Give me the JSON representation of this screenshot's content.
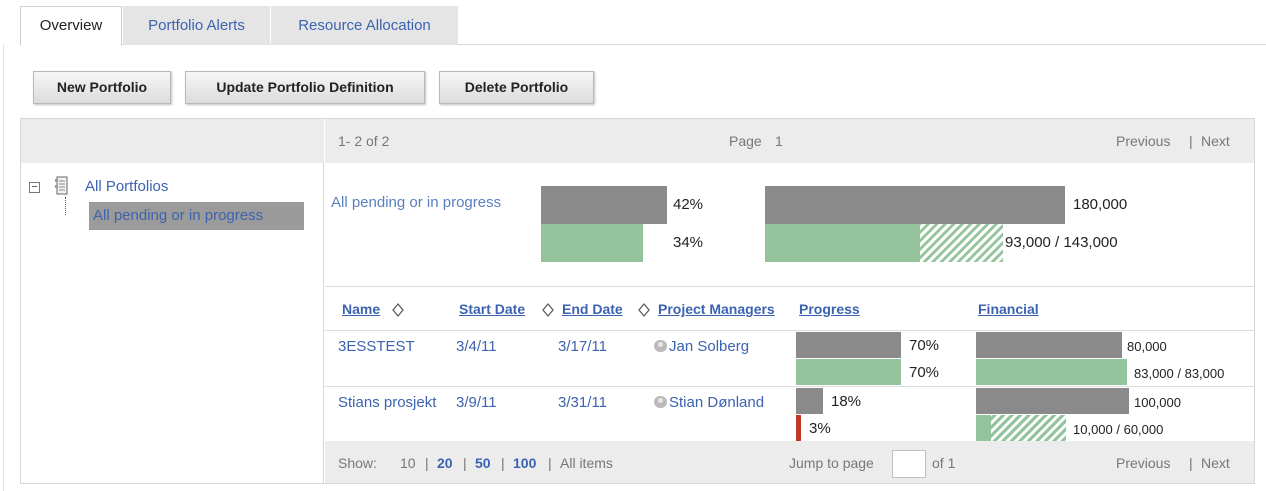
{
  "tabs": [
    {
      "label": "Overview",
      "active": true
    },
    {
      "label": "Portfolio Alerts",
      "active": false
    },
    {
      "label": "Resource Allocation",
      "active": false
    }
  ],
  "toolbar": {
    "new_label": "New Portfolio",
    "update_label": "Update Portfolio Definition",
    "delete_label": "Delete Portfolio"
  },
  "tree": {
    "root_label": "All Portfolios",
    "child_label": "All pending or in progress",
    "toggle": "−"
  },
  "pager_top": {
    "range": "1- 2  of  2",
    "page_label": "Page",
    "page_num": "1",
    "previous": "Previous",
    "divider": "|",
    "next": "Next"
  },
  "summary": {
    "name": "All pending or in progress",
    "progress_planned_label": "42%",
    "progress_planned": 0.42,
    "progress_actual_label": "34%",
    "progress_actual": 0.34,
    "financial_budget_label": "180,000",
    "financial_spent_label": "93,000 / 143,000",
    "financial_spent": 93000,
    "financial_committed": 143000,
    "financial_budget": 180000
  },
  "table": {
    "headers": {
      "name": "Name",
      "start": "Start Date",
      "end": "End Date",
      "managers": "Project Managers",
      "progress": "Progress",
      "financial": "Financial"
    },
    "rows": [
      {
        "name": "3ESSTEST",
        "start": "3/4/11",
        "end": "3/17/11",
        "manager": "Jan Solberg",
        "progress_planned_label": "70%",
        "progress_planned": 0.7,
        "progress_actual_label": "70%",
        "progress_actual": 0.7,
        "budget_label": "80,000",
        "spent_label": "83,000 / 83,000",
        "spent": 83000,
        "committed": 83000,
        "budget": 80000
      },
      {
        "name": "Stians prosjekt",
        "start": "3/9/11",
        "end": "3/31/11",
        "manager": "Stian Dønland",
        "progress_planned_label": "18%",
        "progress_planned": 0.18,
        "progress_actual_label": "3%",
        "progress_actual": 0.03,
        "budget_label": "100,000",
        "spent_label": "10,000 / 60,000",
        "spent": 10000,
        "committed": 60000,
        "budget": 100000
      }
    ]
  },
  "pager_bottom": {
    "show_label": "Show:",
    "sizes": [
      "10",
      "20",
      "50",
      "100"
    ],
    "all_items": "All  items",
    "divider": "|",
    "jump_label": "Jump to page",
    "jump_value": "",
    "of_label": "of 1",
    "previous": "Previous",
    "next": "Next"
  },
  "colors": {
    "link": "#3c63b0",
    "bar_gray": "#8a8a8a",
    "bar_green": "#93c49c",
    "bar_red": "#c0392b"
  }
}
